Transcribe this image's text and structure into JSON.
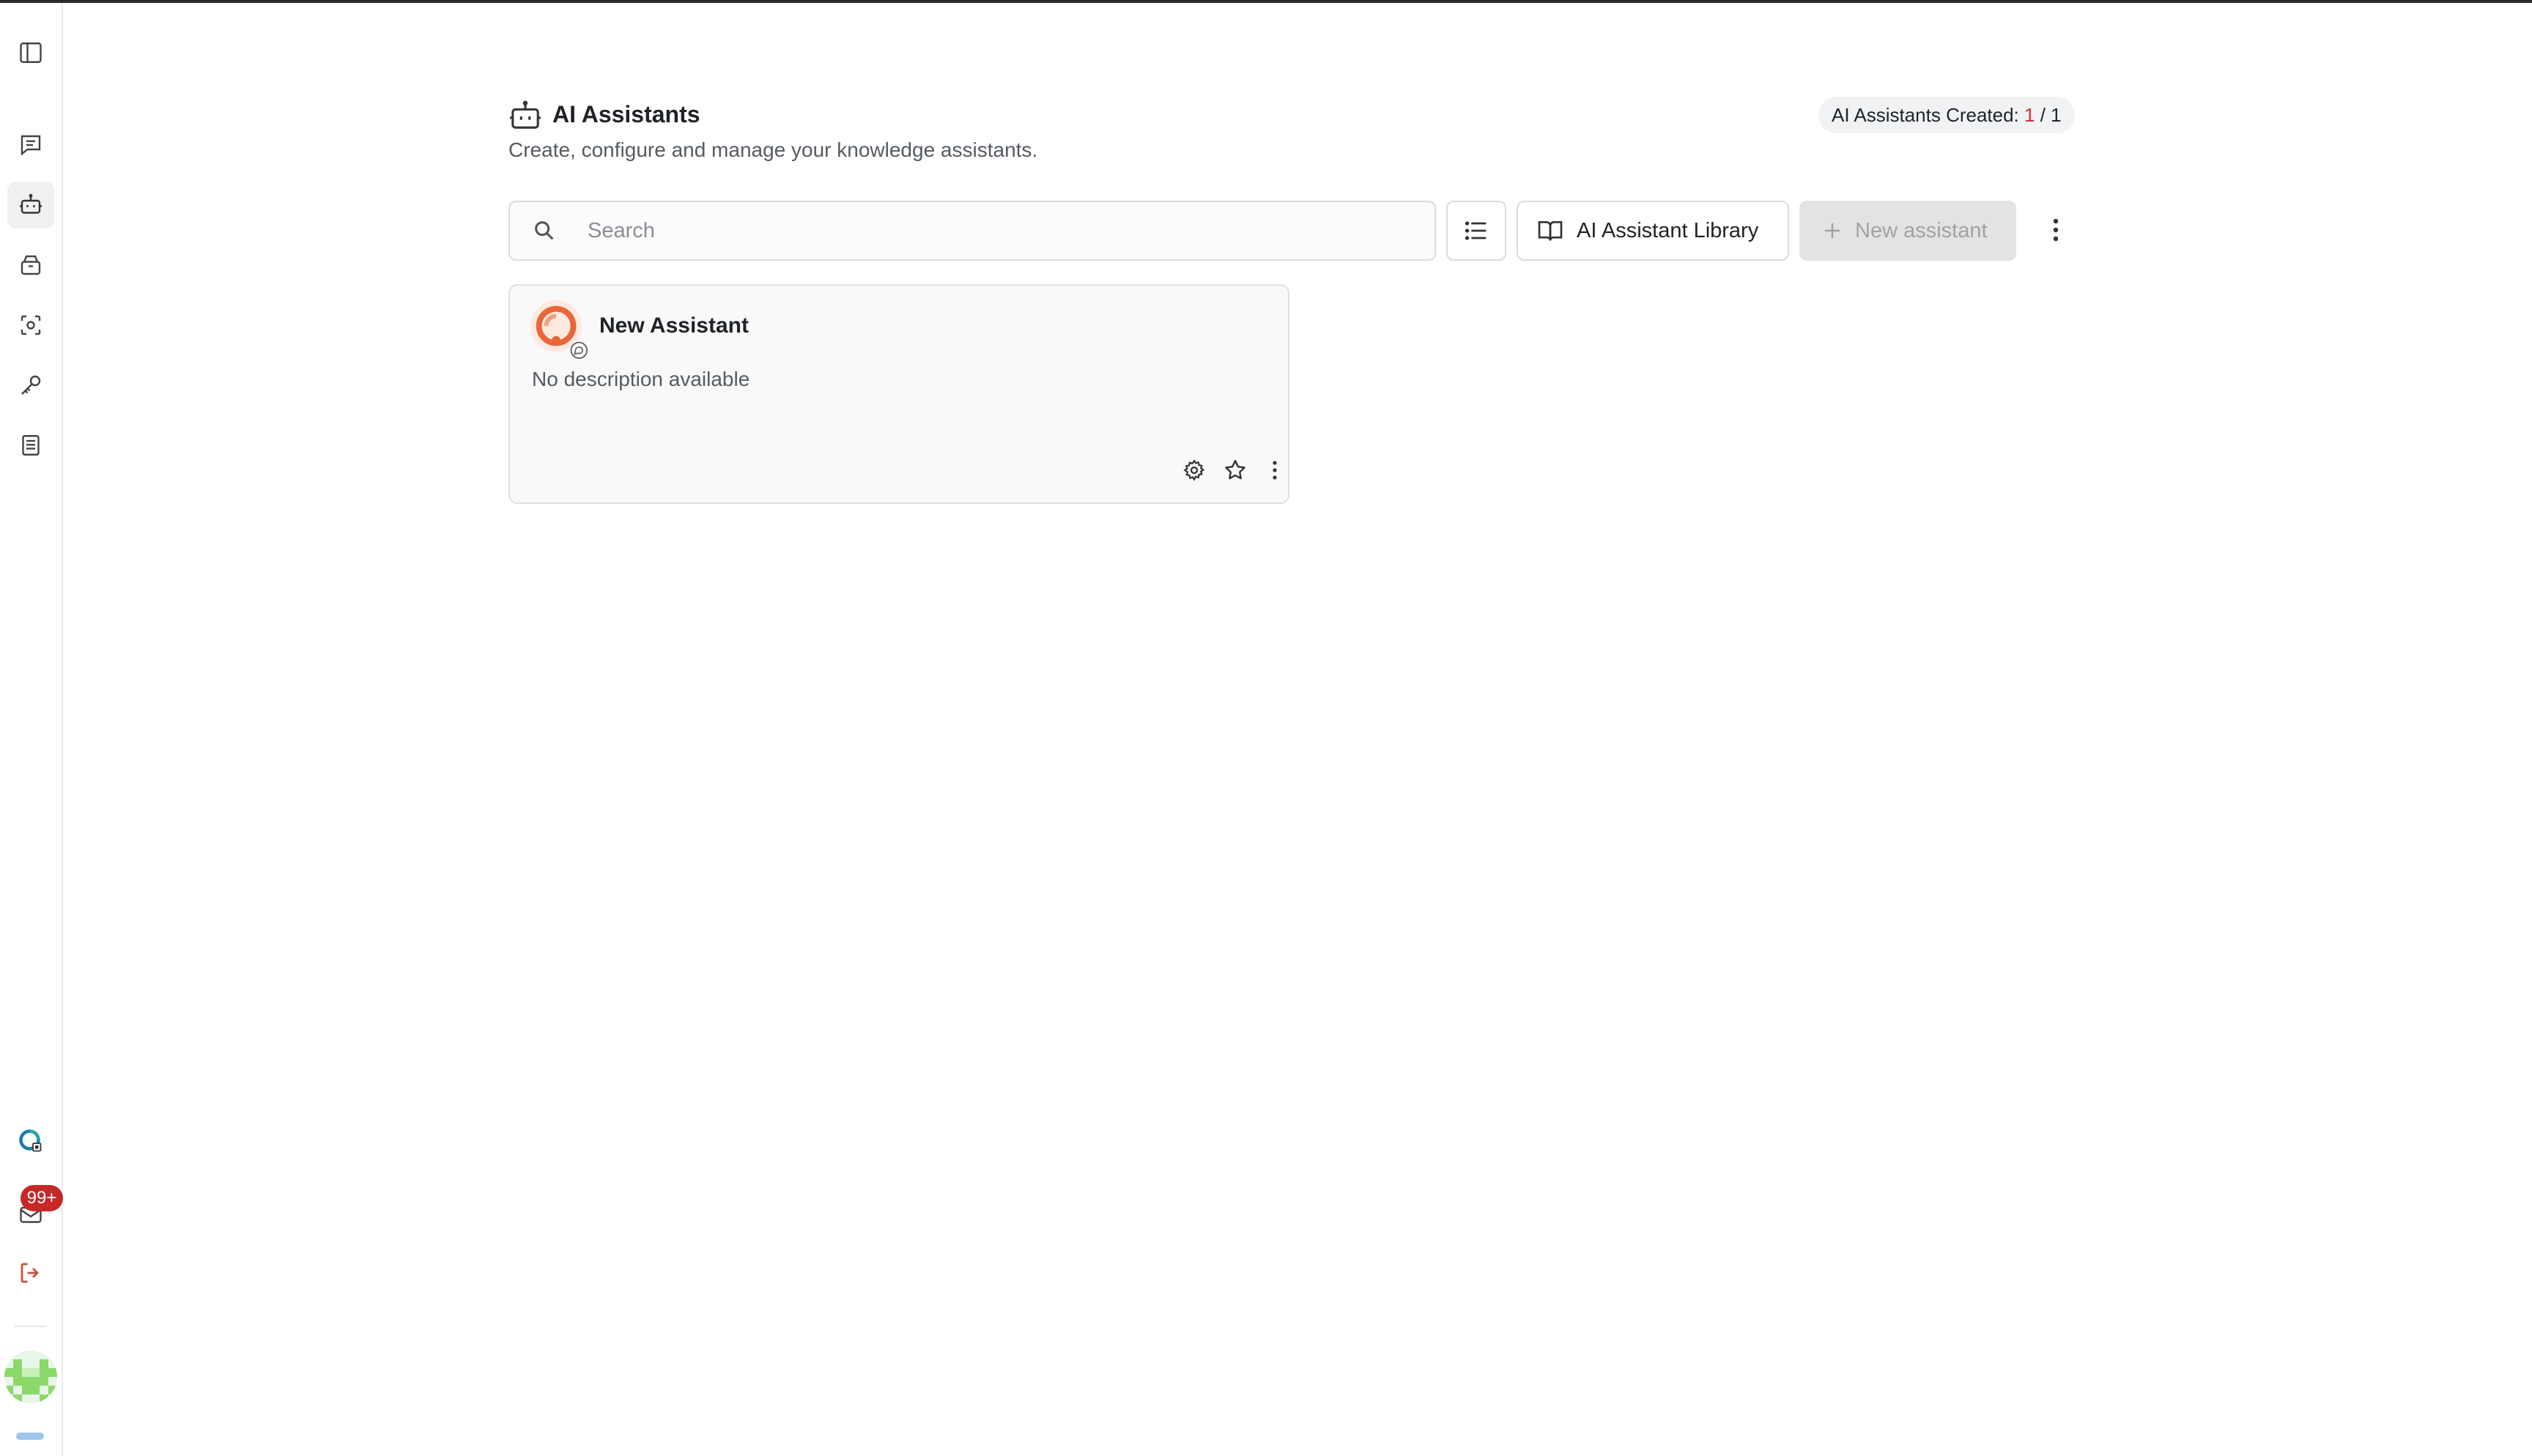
{
  "sidebar": {
    "items": [
      {
        "name": "sidebar-toggle",
        "icon": "panel-left-icon"
      },
      {
        "name": "chats",
        "icon": "message-square-icon"
      },
      {
        "name": "ai-assistants",
        "icon": "bot-icon",
        "active": true
      },
      {
        "name": "library",
        "icon": "archive-icon"
      },
      {
        "name": "scan",
        "icon": "scan-icon"
      },
      {
        "name": "keys",
        "icon": "key-icon"
      },
      {
        "name": "docs",
        "icon": "book-icon"
      }
    ],
    "notifications_badge": "99+",
    "brand_icon": "brand-logo-icon",
    "logout_icon": "log-out-icon"
  },
  "header": {
    "title": "AI Assistants",
    "subtitle": "Create, configure and manage your knowledge assistants.",
    "counter_label": "AI Assistants Created: ",
    "counter_used": "1",
    "counter_sep": " / ",
    "counter_total": "1"
  },
  "toolbar": {
    "search_placeholder": "Search",
    "library_label": "AI Assistant Library",
    "new_label": "New assistant"
  },
  "assistants": [
    {
      "name": "New Assistant",
      "description": "No description available"
    }
  ],
  "colors": {
    "accent_red": "#d32f2f",
    "badge_red": "#c62828",
    "assistant_orange": "#e8663a",
    "brand_teal": "#1b7bb5"
  }
}
